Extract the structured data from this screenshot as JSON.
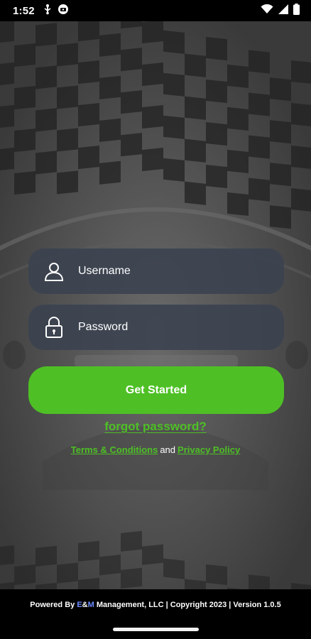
{
  "status_bar": {
    "time": "1:52",
    "icons_left": [
      "usb-debug-icon",
      "vpn-shield-icon"
    ],
    "icons_right": [
      "wifi-icon",
      "signal-icon",
      "battery-icon"
    ]
  },
  "login": {
    "username_placeholder": "Username",
    "password_placeholder": "Password",
    "submit_label": "Get Started",
    "forgot_label": "forgot password?",
    "terms_label": "Terms & Conditions",
    "and_text": "and",
    "privacy_label": "Privacy Policy"
  },
  "footer": {
    "powered_prefix": "Powered By ",
    "company_e": "E",
    "company_amp": "&",
    "company_m": "M",
    "powered_suffix": " Management, LLC | Copyright 2023 | Version 1.0.5"
  },
  "colors": {
    "accent_green": "#4ec025",
    "field_bg": "#3a4250",
    "background": "#4a4a4a",
    "company_blue": "#6b8cff"
  }
}
